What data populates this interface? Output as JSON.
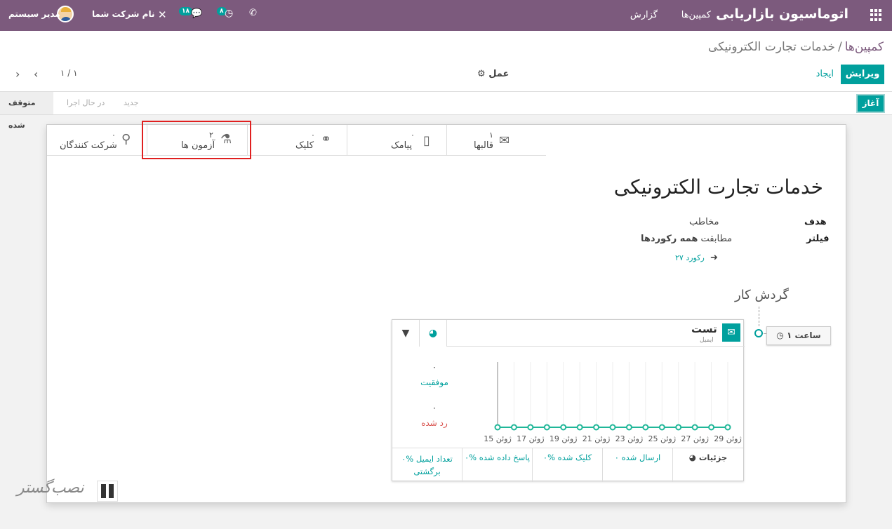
{
  "navbar": {
    "brand": "اتوماسیون بازاریابی",
    "menu": [
      "کمپین‌ها",
      "گزارش"
    ],
    "user": "مدیر سیستم",
    "company": "نام شرکت شما",
    "chat_badge": "۱۸",
    "activity_badge": "۸"
  },
  "breadcrumb": {
    "parent": "کمپین‌ها",
    "separator": "/",
    "current": "خدمات تجارت الکترونیکی"
  },
  "toolbar": {
    "edit": "ویرایش",
    "create": "ایجاد",
    "action": "عمل",
    "pager": "۱ / ۱"
  },
  "statusbar": {
    "start": "آغاز",
    "stages": [
      "جدید",
      "در حال اجرا",
      "متوقف شده"
    ]
  },
  "smart_buttons": [
    {
      "icon": "participants-icon",
      "value": "۰",
      "label": "شرکت کنندگان"
    },
    {
      "icon": "flask-icon",
      "value": "۲",
      "label": "آزمون ها"
    },
    {
      "icon": "link-icon",
      "value": "۰",
      "label": "کلیک"
    },
    {
      "icon": "mobile-icon",
      "value": "۰",
      "label": "پیامک"
    },
    {
      "icon": "envelope-icon",
      "value": "۱",
      "label": "قالبها"
    }
  ],
  "form": {
    "title": "خدمات تجارت الکترونیکی",
    "target_label": "هدف",
    "target_value": "مخاطب",
    "filter_label": "فیلتر",
    "filter_prefix": "مطابقت",
    "filter_value": "همه رکوردها",
    "records": "۲۷ رکورد",
    "workflow_title": "گردش کار",
    "trigger": "۱ ساعت"
  },
  "activity": {
    "name": "تست",
    "type": "ایمیل",
    "success_value": "۰",
    "success_label": "موفقیت",
    "rejected_value": "۰",
    "rejected_label": "رد شده",
    "footer": [
      "جزئیات",
      "۰ ارسال شده",
      "۰% کلیک شده",
      "۰% پاسخ داده شده",
      "۰% تعداد ایمیل برگشتی"
    ]
  },
  "chart_data": {
    "type": "line",
    "x": [
      "15 ژوئن",
      "16 ژوئن",
      "17 ژوئن",
      "18 ژوئن",
      "19 ژوئن",
      "20 ژوئن",
      "21 ژوئن",
      "22 ژوئن",
      "23 ژوئن",
      "24 ژوئن",
      "25 ژوئن",
      "26 ژوئن",
      "27 ژوئن",
      "28 ژوئن",
      "29 ژوئن"
    ],
    "tick_labels": [
      "15 ژوئن",
      "17 ژوئن",
      "19 ژوئن",
      "21 ژوئن",
      "23 ژوئن",
      "25 ژوئن",
      "27 ژوئن",
      "29 ژوئن"
    ],
    "series": [
      {
        "values": [
          0,
          0,
          0,
          0,
          0,
          0,
          0,
          0,
          0,
          0,
          0,
          0,
          0,
          0,
          0
        ],
        "color": "#21b799"
      }
    ],
    "grid": true
  },
  "watermark": "نصب‌گستر"
}
